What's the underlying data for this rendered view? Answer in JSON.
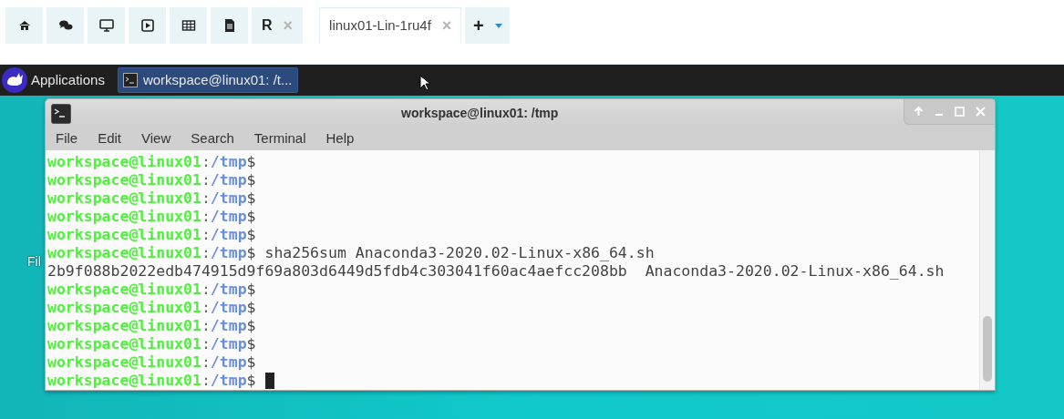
{
  "tabs": [
    {
      "kind": "home",
      "selected": false
    },
    {
      "kind": "chat",
      "selected": false
    },
    {
      "kind": "desktop",
      "selected": false
    },
    {
      "kind": "play",
      "selected": false
    },
    {
      "kind": "table",
      "selected": false
    },
    {
      "kind": "file",
      "selected": false
    },
    {
      "kind": "text",
      "label": "R",
      "close": "×",
      "selected": false
    },
    {
      "kind": "text",
      "label": "linux01-Lin-1ru4f",
      "close": "×",
      "selected": true
    },
    {
      "kind": "add",
      "label": "+",
      "selected": false
    }
  ],
  "panel": {
    "menu": "Applications",
    "task": "workspace@linux01: /t..."
  },
  "desktop_icon_label": "Fil",
  "terminal": {
    "title": "workspace@linux01: /tmp",
    "menu": [
      "File",
      "Edit",
      "View",
      "Search",
      "Terminal",
      "Help"
    ],
    "lines": [
      {
        "kind": "prompt",
        "user": "workspace@linux01",
        "sep": ":",
        "path": "/tmp",
        "sign": "$"
      },
      {
        "kind": "prompt",
        "user": "workspace@linux01",
        "sep": ":",
        "path": "/tmp",
        "sign": "$"
      },
      {
        "kind": "prompt",
        "user": "workspace@linux01",
        "sep": ":",
        "path": "/tmp",
        "sign": "$"
      },
      {
        "kind": "prompt",
        "user": "workspace@linux01",
        "sep": ":",
        "path": "/tmp",
        "sign": "$"
      },
      {
        "kind": "prompt",
        "user": "workspace@linux01",
        "sep": ":",
        "path": "/tmp",
        "sign": "$"
      },
      {
        "kind": "prompt",
        "user": "workspace@linux01",
        "sep": ":",
        "path": "/tmp",
        "sign": "$",
        "command": "sha256sum Anaconda3-2020.02-Linux-x86_64.sh"
      },
      {
        "kind": "output",
        "text": "2b9f088b2022edb474915d9f69a803d6449d5fdb4c303041f60ac4aefcc208bb  Anaconda3-2020.02-Linux-x86_64.sh"
      },
      {
        "kind": "prompt",
        "user": "workspace@linux01",
        "sep": ":",
        "path": "/tmp",
        "sign": "$"
      },
      {
        "kind": "prompt",
        "user": "workspace@linux01",
        "sep": ":",
        "path": "/tmp",
        "sign": "$"
      },
      {
        "kind": "prompt",
        "user": "workspace@linux01",
        "sep": ":",
        "path": "/tmp",
        "sign": "$"
      },
      {
        "kind": "prompt",
        "user": "workspace@linux01",
        "sep": ":",
        "path": "/tmp",
        "sign": "$"
      },
      {
        "kind": "prompt",
        "user": "workspace@linux01",
        "sep": ":",
        "path": "/tmp",
        "sign": "$"
      },
      {
        "kind": "prompt",
        "user": "workspace@linux01",
        "sep": ":",
        "path": "/tmp",
        "sign": "$",
        "cursor": true
      }
    ]
  }
}
